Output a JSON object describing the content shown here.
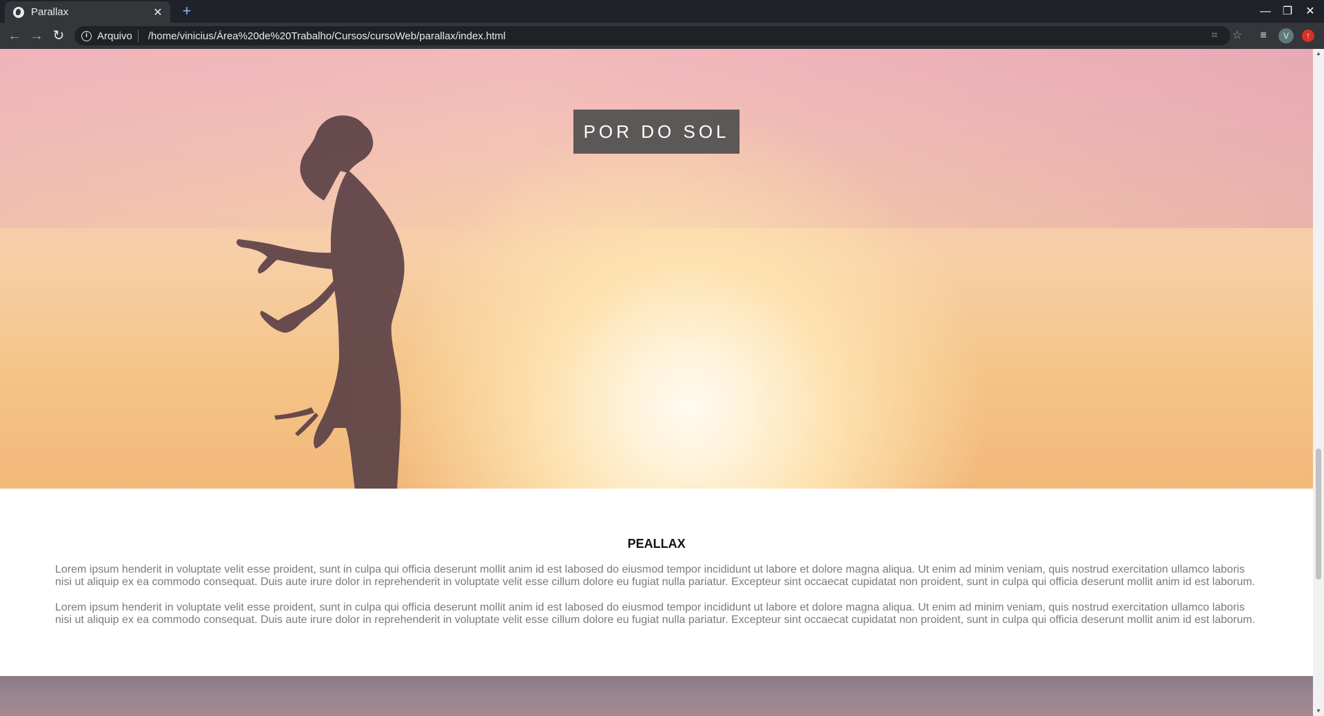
{
  "browser": {
    "tab": {
      "title": "Parallax",
      "close": "✕"
    },
    "new_tab": "+",
    "window_controls": {
      "minimize": "—",
      "restore": "❐",
      "close": "✕"
    },
    "nav": {
      "back": "←",
      "forward": "→",
      "reload": "↻"
    },
    "omnibox": {
      "scheme_label": "Arquivo",
      "url": "/home/vinicius/Área%20de%20Trabalho/Cursos/cursoWeb/parallax/index.html"
    },
    "profile_initial": "V"
  },
  "page": {
    "hero_title": "POR DO SOL",
    "section_title": "PEALLAX",
    "paragraphs": [
      "Lorem ipsum henderit in voluptate velit esse proident, sunt in culpa qui officia deserunt mollit anim id est labosed do eiusmod tempor incididunt ut labore et dolore magna aliqua. Ut enim ad minim veniam, quis nostrud exercitation ullamco laboris nisi ut aliquip ex ea commodo consequat. Duis aute irure dolor in reprehenderit in voluptate velit esse cillum dolore eu fugiat nulla pariatur. Excepteur sint occaecat cupidatat non proident, sunt in culpa qui officia deserunt mollit anim id est laborum.",
      "Lorem ipsum henderit in voluptate velit esse proident, sunt in culpa qui officia deserunt mollit anim id est labosed do eiusmod tempor incididunt ut labore et dolore magna aliqua. Ut enim ad minim veniam, quis nostrud exercitation ullamco laboris nisi ut aliquip ex ea commodo consequat. Duis aute irure dolor in reprehenderit in voluptate velit esse cillum dolore eu fugiat nulla pariatur. Excepteur sint occaecat cupidatat non proident, sunt in culpa qui officia deserunt mollit anim id est laborum."
    ]
  },
  "icons": {
    "favicon": "globe-icon",
    "info": "info-icon",
    "translate": "translate-icon",
    "bookmark": "star-icon",
    "media": "media-queue-icon",
    "extension": "extension-icon"
  },
  "colors": {
    "tab_bar": "#1f2229",
    "toolbar": "#35363a",
    "title_box": "#505050",
    "body_text": "#7a7a7a"
  }
}
